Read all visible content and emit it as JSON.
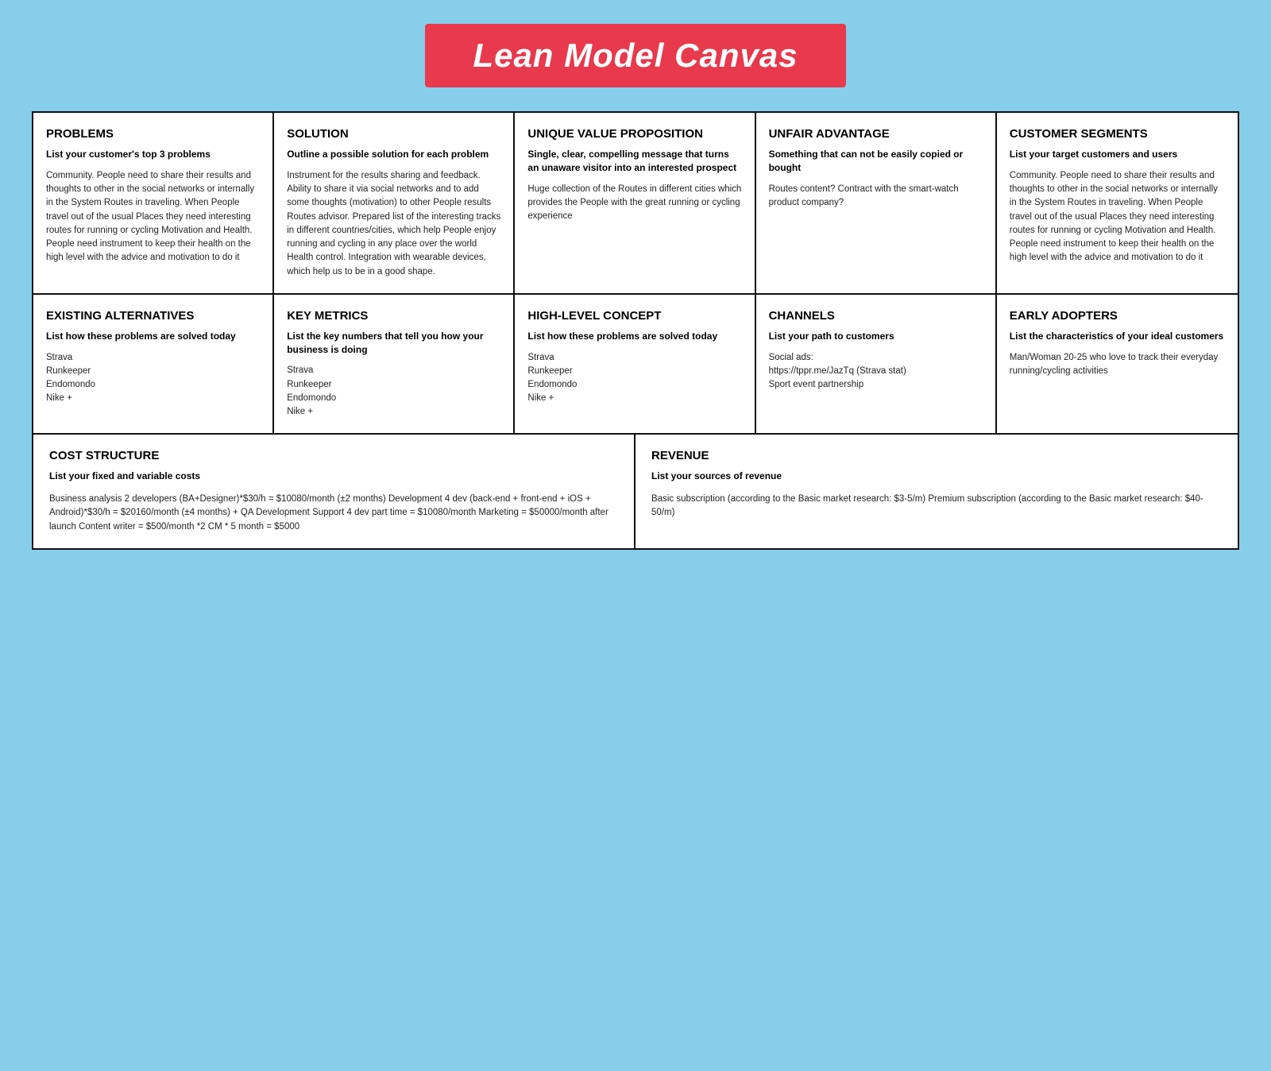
{
  "title": "Lean Model Canvas",
  "cells": {
    "problems": {
      "title": "PROBLEMS",
      "subtitle": "List your customer's top 3 problems",
      "body": "Community. People need to share their results and thoughts to other in the social networks or internally in the System Routes in traveling. When People travel out of the usual Places they need interesting routes for running or cycling Motivation and Health. People need instrument to keep their health on the high level with the advice and motivation to do it"
    },
    "solution": {
      "title": "SOLUTION",
      "subtitle": "Outline a possible solution  for each problem",
      "body": "Instrument for the results sharing and feedback. Ability to share it via social networks and to add some thoughts (motivation) to other People results Routes advisor. Prepared list of the interesting tracks in different countries/cities, which help People enjoy running and cycling in any place over the world Health control. Integration with wearable devices, which help us to be in a good shape."
    },
    "unique_value": {
      "title": "UNIQUE VALUE PROPOSITION",
      "subtitle": "Single, clear, compelling message that turns an unaware visitor into an interested prospect",
      "body": "Huge collection of the Routes in different cities which provides the People with the great running or cycling experience"
    },
    "unfair_advantage": {
      "title": "UNFAIR ADVANTAGE",
      "subtitle": "Something that can not be easily copied or bought",
      "body": "Routes content?  Contract with the smart-watch product company?"
    },
    "customer_segments": {
      "title": "CUSTOMER SEGMENTS",
      "subtitle": "List your target customers and users",
      "body": "Community. People need to share their results and thoughts to other in the social networks or internally in the System Routes in traveling. When People travel out of the usual Places they need interesting routes for running or cycling Motivation and Health. People need instrument to keep their health on the high level with the advice and motivation to do it"
    },
    "existing_alternatives": {
      "title": "EXISTING ALTERNATIVES",
      "subtitle": "List how these problems are solved today",
      "body": "Strava\nRunkeeper\nEndomondo\nNike +"
    },
    "key_metrics": {
      "title": "KEY METRICS",
      "subtitle": "List the key numbers that tell you how your business is doing",
      "body": "Strava\nRunkeeper\nEndomondo\nNike +"
    },
    "high_level_concept": {
      "title": "HIGH-LEVEL CONCEPT",
      "subtitle": "List how these problems are solved today",
      "body": "Strava\nRunkeeper\nEndomondo\nNike +"
    },
    "channels": {
      "title": "CHANNELS",
      "subtitle": "List your path to customers",
      "body": "Social ads:\nhttps://tppr.me/JazTq (Strava stat)\nSport event partnership"
    },
    "early_adopters": {
      "title": "EARLY ADOPTERS",
      "subtitle": "List the characteristics of your ideal customers",
      "body": "Man/Woman 20-25 who love to track their everyday running/cycling activities"
    },
    "cost_structure": {
      "title": "COST STRUCTURE",
      "subtitle": "List your fixed and variable costs",
      "body": "Business analysis 2 developers (BA+Designer)*$30/h = $10080/month (±2 months) Development 4 dev (back-end + front-end + iOS + Android)*$30/h = $20160/month (±4 months) + QA Development Support 4 dev part time = $10080/month Marketing = $50000/month after launch  Content writer = $500/month *2 CM * 5 month = $5000"
    },
    "revenue": {
      "title": "REVENUE",
      "subtitle": "List your sources of revenue",
      "body": "Basic subscription (according to the Basic market research: $3-5/m) Premium subscription (according to the Basic market research: $40-50/m)"
    }
  }
}
